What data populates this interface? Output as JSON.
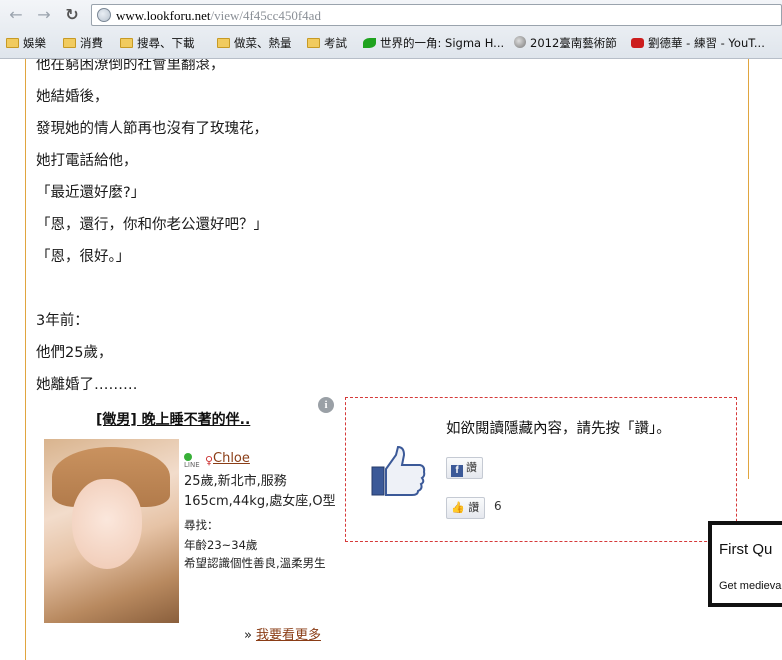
{
  "browser": {
    "url_domain": "www.lookforu.net",
    "url_path": "/view/4f45cc450f4ad",
    "bookmarks": [
      {
        "label": "娛樂",
        "icon": "folder-icon"
      },
      {
        "label": "消費",
        "icon": "folder-icon"
      },
      {
        "label": "搜尋、下載",
        "icon": "folder-icon"
      },
      {
        "label": "做菜、熱量",
        "icon": "folder-icon"
      },
      {
        "label": "考試",
        "icon": "folder-icon"
      },
      {
        "label": "世界的一角: Sigma H...",
        "icon": "leaf-icon"
      },
      {
        "label": "2012臺南藝術節",
        "icon": "globe-icon"
      },
      {
        "label": "劉德華 - 練習 - YouT...",
        "icon": "youtube-icon"
      }
    ]
  },
  "article": {
    "lines": [
      "他在窮困潦倒的社會里翻滾，",
      "她結婚後，",
      "發現她的情人節再也沒有了玫瑰花，",
      "她打電話給他，",
      "「最近還好麼?」",
      "「恩，還行，你和你老公還好吧？」",
      "「恩，很好。」",
      "",
      "3年前：",
      "他們25歲，",
      "她離婚了………"
    ]
  },
  "ad": {
    "info_glyph": "i",
    "title": "[徵男] 晚上睡不著的伴..",
    "status_tag": "LINE",
    "gender_glyph": "♀",
    "name": "Chloe",
    "profile_line1": "25歲,新北市,服務",
    "profile_line2": "165cm,44kg,處女座,O型",
    "seek_label": "尋找：",
    "seek_age": "年齡23~34歲",
    "seek_desc": "希望認識個性善良,溫柔男生",
    "more_arrow": "»",
    "more_link": "我要看更多"
  },
  "likegate": {
    "message": "如欲閱讀隱藏內容，請先按「讚」。",
    "fb_button_label": "讚",
    "fb_icon_glyph": "f",
    "like_button_label": "讚",
    "like_count": "6"
  },
  "popup": {
    "heading": "First Qu",
    "subtext": "Get medieva"
  },
  "colors": {
    "border_orange": "#e0a53f",
    "dashed_red": "#d63a3a",
    "facebook_blue": "#3b5998",
    "link_brown": "#8a3d16"
  }
}
